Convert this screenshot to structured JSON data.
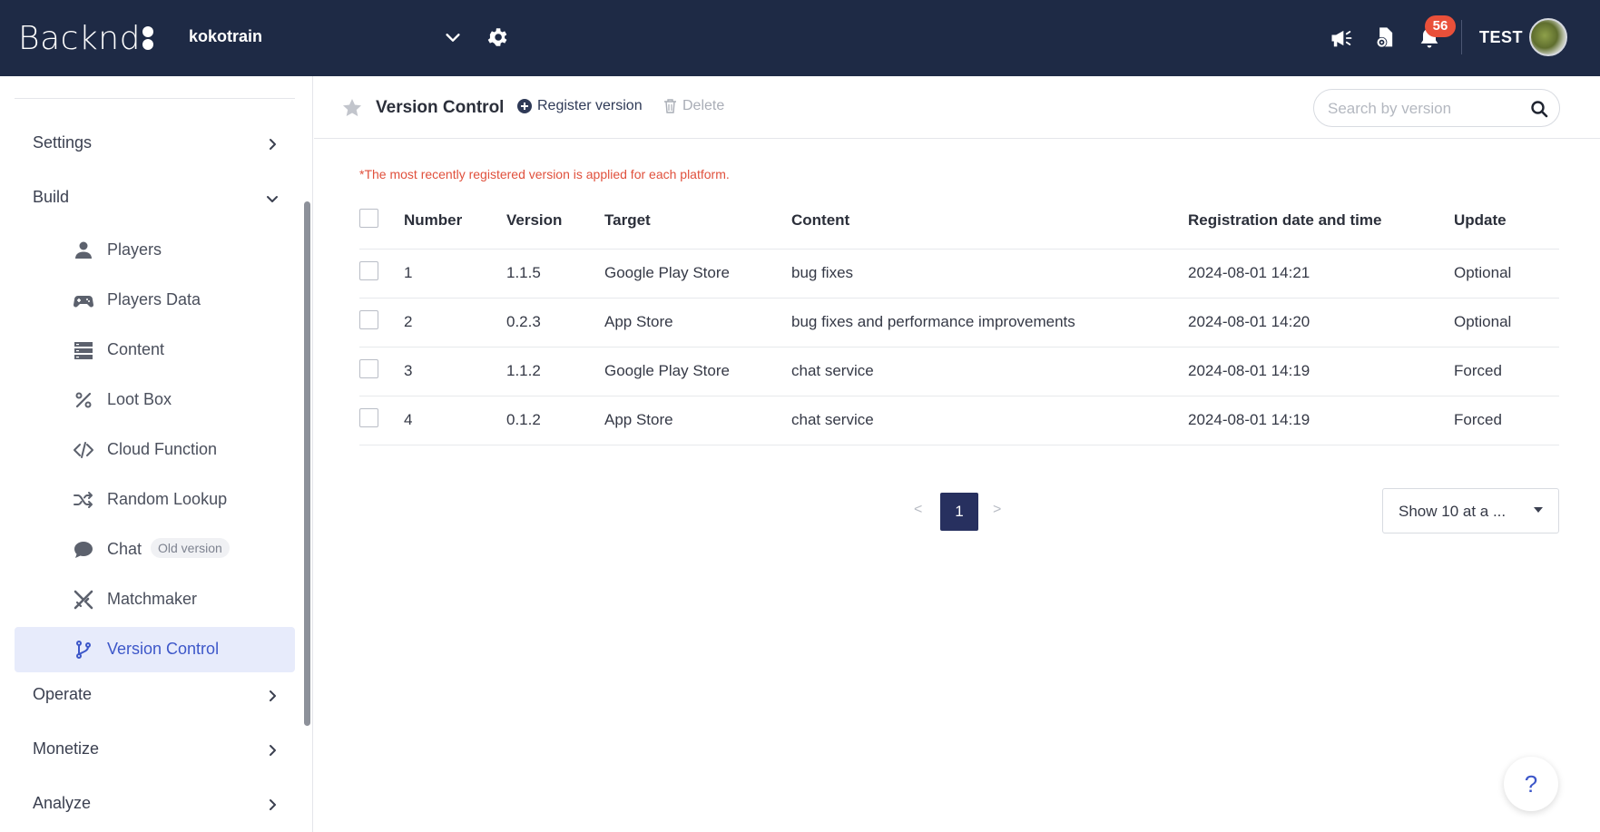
{
  "app": {
    "logo_text": "Backnd",
    "project_name": "kokotrain"
  },
  "topbar": {
    "notification_count": "56",
    "user_name": "TEST"
  },
  "sidebar": {
    "sections": {
      "settings": "Settings",
      "build": "Build",
      "operate": "Operate",
      "monetize": "Monetize",
      "analyze": "Analyze"
    },
    "build_items": [
      {
        "label": "Players",
        "icon": "user-icon"
      },
      {
        "label": "Players Data",
        "icon": "gamepad-icon"
      },
      {
        "label": "Content",
        "icon": "server-icon"
      },
      {
        "label": "Loot Box",
        "icon": "percent-icon"
      },
      {
        "label": "Cloud Function",
        "icon": "code-icon"
      },
      {
        "label": "Random Lookup",
        "icon": "shuffle-icon"
      },
      {
        "label": "Chat",
        "icon": "chat-bubble-icon",
        "badge": "Old version"
      },
      {
        "label": "Matchmaker",
        "icon": "crossed-swords-icon"
      },
      {
        "label": "Version Control",
        "icon": "branch-icon",
        "active": true
      }
    ]
  },
  "toolbar": {
    "title": "Version Control",
    "register_label": "Register version",
    "delete_label": "Delete",
    "search_placeholder": "Search by version"
  },
  "notice": "*The most recently registered version is applied for each platform.",
  "table": {
    "headers": [
      "Number",
      "Version",
      "Target",
      "Content",
      "Registration date and time",
      "Update"
    ],
    "rows": [
      [
        "1",
        "1.1.5",
        "Google Play Store",
        "bug fixes",
        "2024-08-01 14:21",
        "Optional"
      ],
      [
        "2",
        "0.2.3",
        "App Store",
        "bug fixes and performance improvements",
        "2024-08-01 14:20",
        "Optional"
      ],
      [
        "3",
        "1.1.2",
        "Google Play Store",
        "chat service",
        "2024-08-01 14:19",
        "Forced"
      ],
      [
        "4",
        "0.1.2",
        "App Store",
        "chat service",
        "2024-08-01 14:19",
        "Forced"
      ]
    ]
  },
  "pagination": {
    "prev": "<",
    "current": "1",
    "next": ">",
    "page_size": "Show 10 at a ..."
  },
  "help": "?",
  "colors": {
    "topbar": "#1e2a45",
    "accent": "#3d57c9",
    "notice": "#e0503c",
    "badge": "#e9503a",
    "page_current": "#27305f"
  }
}
